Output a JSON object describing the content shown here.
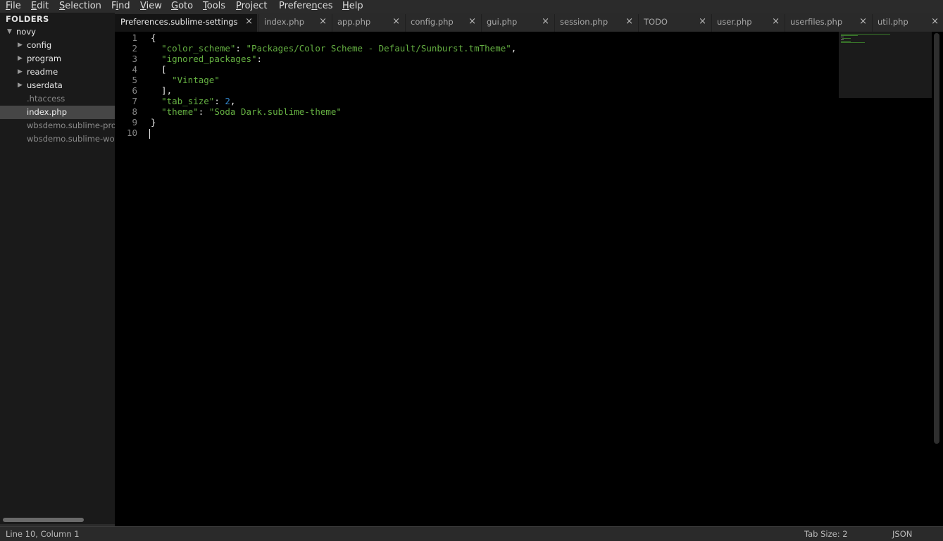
{
  "menu": [
    {
      "underline": "F",
      "rest": "ile"
    },
    {
      "underline": "E",
      "rest": "dit"
    },
    {
      "underline": "S",
      "rest": "election"
    },
    {
      "pre": "F",
      "underline": "i",
      "rest": "nd"
    },
    {
      "underline": "V",
      "rest": "iew"
    },
    {
      "underline": "G",
      "rest": "oto"
    },
    {
      "underline": "T",
      "rest": "ools"
    },
    {
      "underline": "P",
      "rest": "roject"
    },
    {
      "pre": "Prefere",
      "underline": "n",
      "rest": "ces"
    },
    {
      "underline": "H",
      "rest": "elp"
    }
  ],
  "sidebar": {
    "header": "FOLDERS",
    "items": [
      {
        "label": "novy",
        "type": "folder",
        "arrow": "▼",
        "depth": 0
      },
      {
        "label": "config",
        "type": "folder",
        "arrow": "▶",
        "depth": 1
      },
      {
        "label": "program",
        "type": "folder",
        "arrow": "▶",
        "depth": 1
      },
      {
        "label": "readme",
        "type": "folder",
        "arrow": "▶",
        "depth": 1
      },
      {
        "label": "userdata",
        "type": "folder",
        "arrow": "▶",
        "depth": 1
      },
      {
        "label": ".htaccess",
        "type": "file",
        "depth": 1
      },
      {
        "label": "index.php",
        "type": "file",
        "depth": 1,
        "selected": true
      },
      {
        "label": "wbsdemo.sublime-project",
        "type": "file",
        "depth": 1
      },
      {
        "label": "wbsdemo.sublime-workspace",
        "type": "file",
        "depth": 1
      }
    ]
  },
  "tabs": [
    {
      "label": "Preferences.sublime-settings",
      "active": true
    },
    {
      "label": "index.php"
    },
    {
      "label": "app.php"
    },
    {
      "label": "config.php"
    },
    {
      "label": "gui.php"
    },
    {
      "label": "session.php"
    },
    {
      "label": "TODO"
    },
    {
      "label": "user.php"
    },
    {
      "label": "userfiles.php"
    },
    {
      "label": "util.php"
    }
  ],
  "tab_close_glyph": "×",
  "editor": {
    "line_numbers": [
      "1",
      "2",
      "3",
      "4",
      "5",
      "6",
      "7",
      "8",
      "9",
      "10"
    ],
    "lines": [
      [
        {
          "t": "{",
          "c": "p"
        }
      ],
      [
        {
          "t": "  ",
          "c": "p"
        },
        {
          "t": "\"color_scheme\"",
          "c": "s"
        },
        {
          "t": ": ",
          "c": "p"
        },
        {
          "t": "\"Packages/Color Scheme - Default/Sunburst.tmTheme\"",
          "c": "s"
        },
        {
          "t": ",",
          "c": "p"
        }
      ],
      [
        {
          "t": "  ",
          "c": "p"
        },
        {
          "t": "\"ignored_packages\"",
          "c": "s"
        },
        {
          "t": ":",
          "c": "p"
        }
      ],
      [
        {
          "t": "  [",
          "c": "p"
        }
      ],
      [
        {
          "t": "    ",
          "c": "p"
        },
        {
          "t": "\"Vintage\"",
          "c": "s"
        }
      ],
      [
        {
          "t": "  ],",
          "c": "p"
        }
      ],
      [
        {
          "t": "  ",
          "c": "p"
        },
        {
          "t": "\"tab_size\"",
          "c": "s"
        },
        {
          "t": ": ",
          "c": "p"
        },
        {
          "t": "2",
          "c": "n"
        },
        {
          "t": ",",
          "c": "p"
        }
      ],
      [
        {
          "t": "  ",
          "c": "p"
        },
        {
          "t": "\"theme\"",
          "c": "s"
        },
        {
          "t": ": ",
          "c": "p"
        },
        {
          "t": "\"Soda Dark.sublime-theme\"",
          "c": "s"
        }
      ],
      [
        {
          "t": "}",
          "c": "p"
        }
      ],
      []
    ]
  },
  "status": {
    "position": "Line 10, Column 1",
    "tab_size": "Tab Size: 2",
    "syntax": "JSON"
  },
  "colors": {
    "string": "#65b042",
    "number": "#3387cc",
    "background": "#000000"
  }
}
